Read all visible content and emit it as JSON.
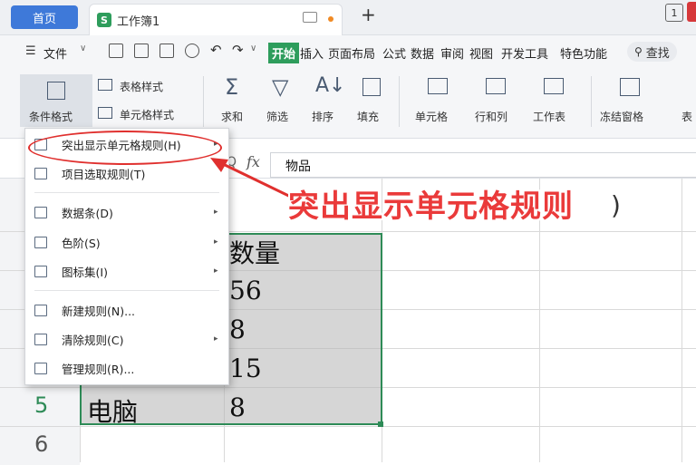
{
  "tabs": {
    "home": "首页",
    "doc_icon": "S",
    "doc_title": "工作簿1",
    "new_tab": "+",
    "page_badge": "1"
  },
  "menubar": {
    "file": "文件",
    "items": [
      "开始",
      "插入",
      "页面布局",
      "公式",
      "数据",
      "审阅",
      "视图",
      "开发工具",
      "特色功能"
    ],
    "search": "查找"
  },
  "ribbon": {
    "cond_format": "条件格式",
    "table_style": "表格样式",
    "cell_style": "单元格样式",
    "sum": "求和",
    "filter": "筛选",
    "sort": "排序",
    "fill": "填充",
    "cell": "单元格",
    "rowcol": "行和列",
    "worksheet": "工作表",
    "freeze": "冻结窗格",
    "table_cut": "表"
  },
  "formula_bar": {
    "fx": "fx",
    "value": "物品"
  },
  "sheet": {
    "header_cell": "数量",
    "rows": [
      {
        "num": "",
        "a": "",
        "b": "56"
      },
      {
        "num": "",
        "a": "",
        "b": "8"
      },
      {
        "num": "",
        "a": "",
        "b": "15"
      },
      {
        "num": "5",
        "a": "电脑",
        "b": "8"
      },
      {
        "num": "6",
        "a": "",
        "b": ""
      }
    ],
    "partial_glyph": ")"
  },
  "dropdown": {
    "items": [
      {
        "label": "突出显示单元格规则(H)",
        "submenu": true
      },
      {
        "label": "项目选取规则(T)",
        "submenu": false
      },
      {
        "label": "数据条(D)",
        "submenu": true
      },
      {
        "label": "色阶(S)",
        "submenu": true
      },
      {
        "label": "图标集(I)",
        "submenu": true
      },
      {
        "label": "新建规则(N)...",
        "submenu": false
      },
      {
        "label": "清除规则(C)",
        "submenu": true
      },
      {
        "label": "管理规则(R)...",
        "submenu": false
      }
    ]
  },
  "annotation": {
    "text": "突出显示单元格规则",
    "color": "#ea3a3a"
  },
  "colors": {
    "home_tab": "#3e79d9",
    "accent_green": "#2e9d5c"
  }
}
